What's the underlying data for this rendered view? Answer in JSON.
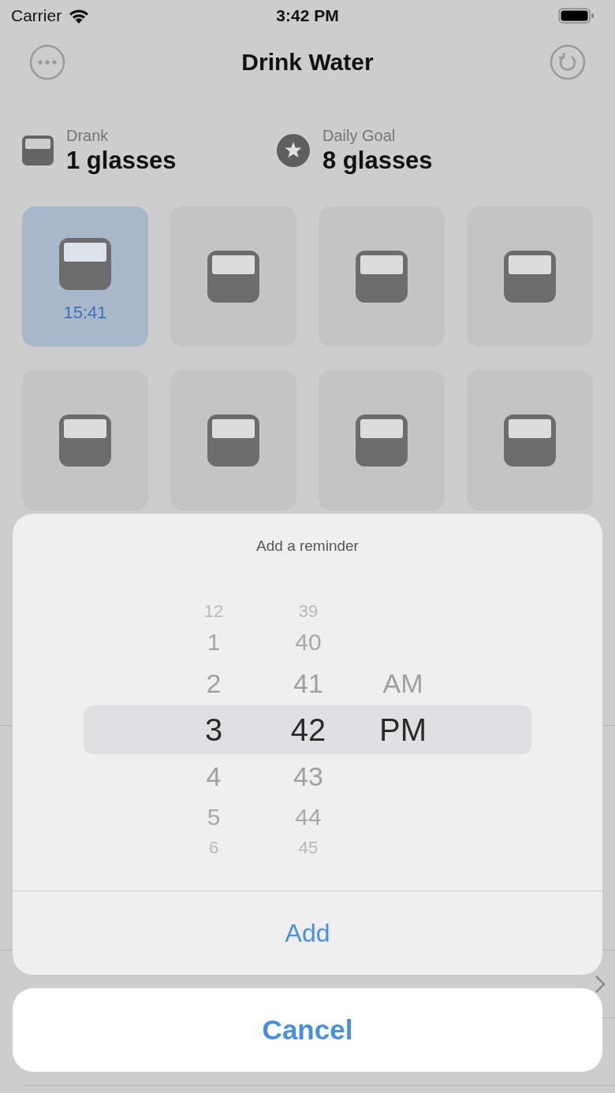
{
  "status_bar": {
    "carrier": "Carrier",
    "time": "3:42 PM"
  },
  "nav": {
    "title": "Drink Water"
  },
  "stats": [
    {
      "kind": "glass",
      "label": "Drank",
      "value": "1 glasses"
    },
    {
      "kind": "star",
      "label": "Daily Goal",
      "value": "8 glasses"
    }
  ],
  "tiles": [
    {
      "selected": true,
      "time": "15:41"
    },
    {
      "selected": false
    },
    {
      "selected": false
    },
    {
      "selected": false
    },
    {
      "selected": false
    },
    {
      "selected": false
    },
    {
      "selected": false
    },
    {
      "selected": false
    }
  ],
  "sheet": {
    "title": "Add a reminder",
    "columns": [
      {
        "items": [
          {
            "label": "12",
            "selected": false
          },
          {
            "label": "1",
            "selected": false
          },
          {
            "label": "2",
            "selected": false
          },
          {
            "label": "3",
            "selected": true
          },
          {
            "label": "4",
            "selected": false
          },
          {
            "label": "5",
            "selected": false
          },
          {
            "label": "6",
            "selected": false
          }
        ]
      },
      {
        "items": [
          {
            "label": "39",
            "selected": false
          },
          {
            "label": "40",
            "selected": false
          },
          {
            "label": "41",
            "selected": false
          },
          {
            "label": "42",
            "selected": true
          },
          {
            "label": "43",
            "selected": false
          },
          {
            "label": "44",
            "selected": false
          },
          {
            "label": "45",
            "selected": false
          }
        ]
      },
      {
        "items": [
          {
            "label": "AM",
            "selected": false
          },
          {
            "label": "PM",
            "selected": true
          }
        ]
      }
    ],
    "action": "Add",
    "cancel": "Cancel"
  }
}
